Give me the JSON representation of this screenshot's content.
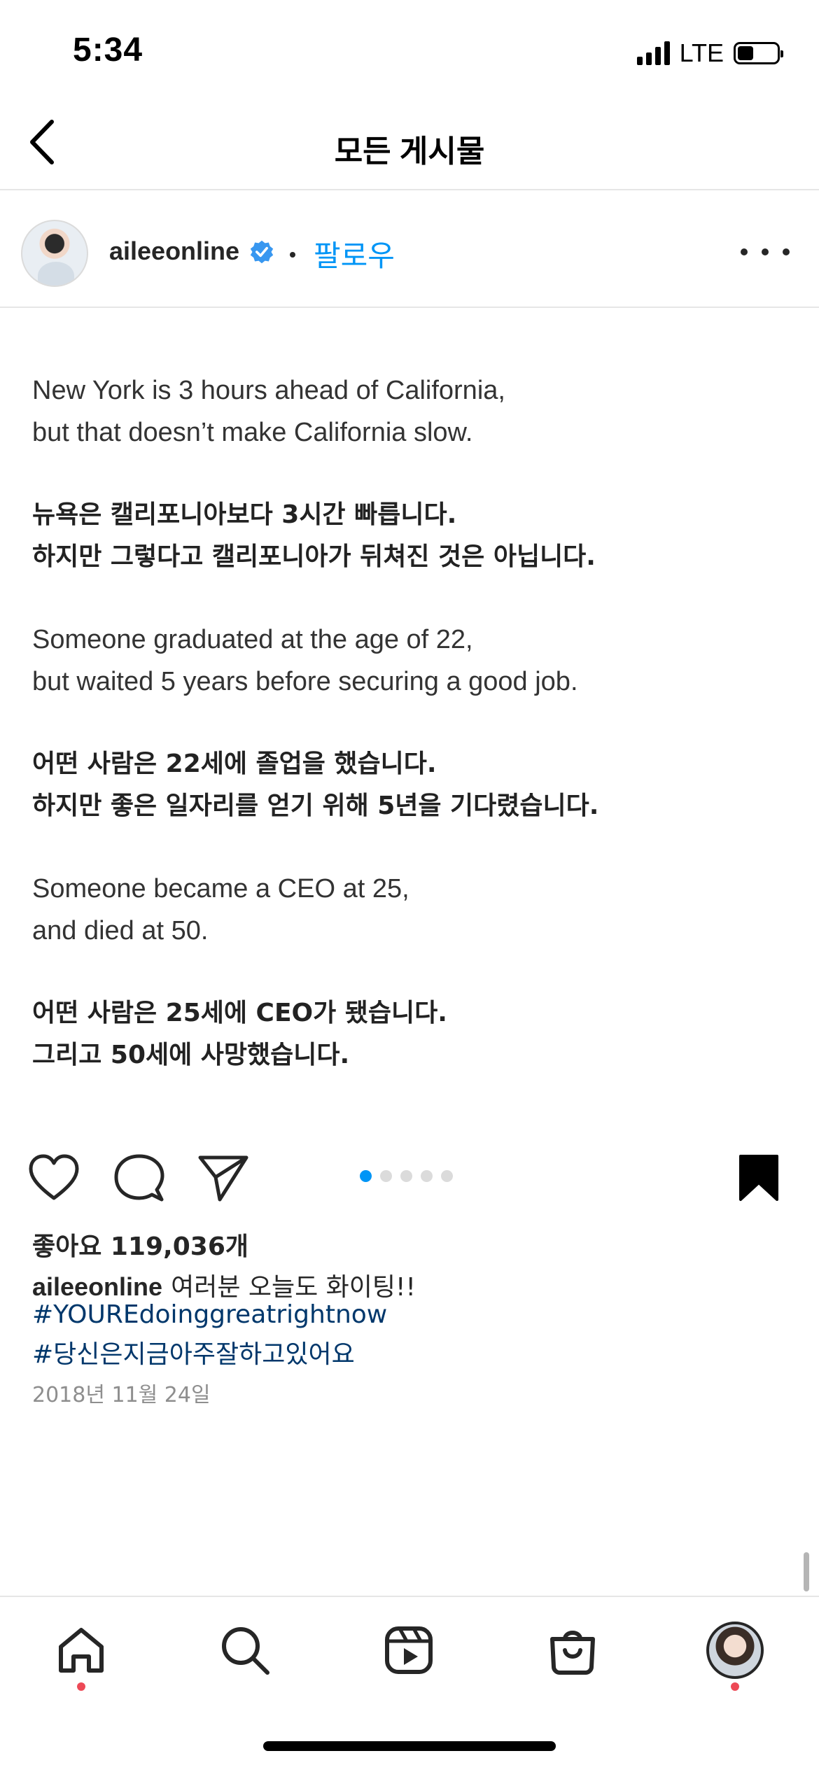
{
  "status_bar": {
    "time": "5:34",
    "network": "LTE",
    "icons": [
      "signal-icon",
      "battery-icon"
    ]
  },
  "header": {
    "title": "모든 게시물",
    "back_icon": "chevron-left-icon"
  },
  "post": {
    "username": "aileeonline",
    "verified": true,
    "separator": "•",
    "follow_label": "팔로우",
    "more_icon": "more-horizontal-icon",
    "image_text": [
      {
        "lang": "en",
        "lines": [
          "New York is 3 hours ahead of California,",
          "but that doesn’t make California slow."
        ]
      },
      {
        "lang": "ko",
        "lines": [
          "뉴욕은 캘리포니아보다 3시간 빠릅니다.",
          "하지만 그렇다고 캘리포니아가 뒤쳐진 것은 아닙니다."
        ]
      },
      {
        "lang": "en",
        "lines": [
          "Someone graduated at the age of 22,",
          "but waited 5 years before securing a good job."
        ]
      },
      {
        "lang": "ko",
        "lines": [
          "어떤 사람은 22세에 졸업을 했습니다.",
          "하지만 좋은 일자리를 얻기 위해 5년을 기다렸습니다."
        ]
      },
      {
        "lang": "en",
        "lines": [
          "Someone became a CEO at 25,",
          "and died at 50."
        ]
      },
      {
        "lang": "ko",
        "lines": [
          "어떤 사람은 25세에 CEO가 됐습니다.",
          "그리고 50세에 사망했습니다."
        ]
      }
    ],
    "carousel": {
      "count": 5,
      "active_index": 0
    },
    "actions": [
      "heart-icon",
      "comment-icon",
      "send-icon",
      "bookmark-icon"
    ],
    "likes_text": "좋아요 119,036개",
    "caption_user": "aileeonline",
    "caption_text": "여러분 오늘도 화이팅!!",
    "hashtags": [
      "#YOUREdoinggreatrightnow",
      "#당신은지금아주잘하고있어요"
    ],
    "date": "2018년 11월 24일"
  },
  "tab_bar": {
    "tabs": [
      "home-icon",
      "search-icon",
      "reels-icon",
      "shop-icon",
      "profile-avatar"
    ],
    "notification_color": "#ed4956"
  },
  "colors": {
    "accent": "#0095f6",
    "hashtag": "#00376b",
    "text": "#262626",
    "muted": "#8e8e8e"
  }
}
